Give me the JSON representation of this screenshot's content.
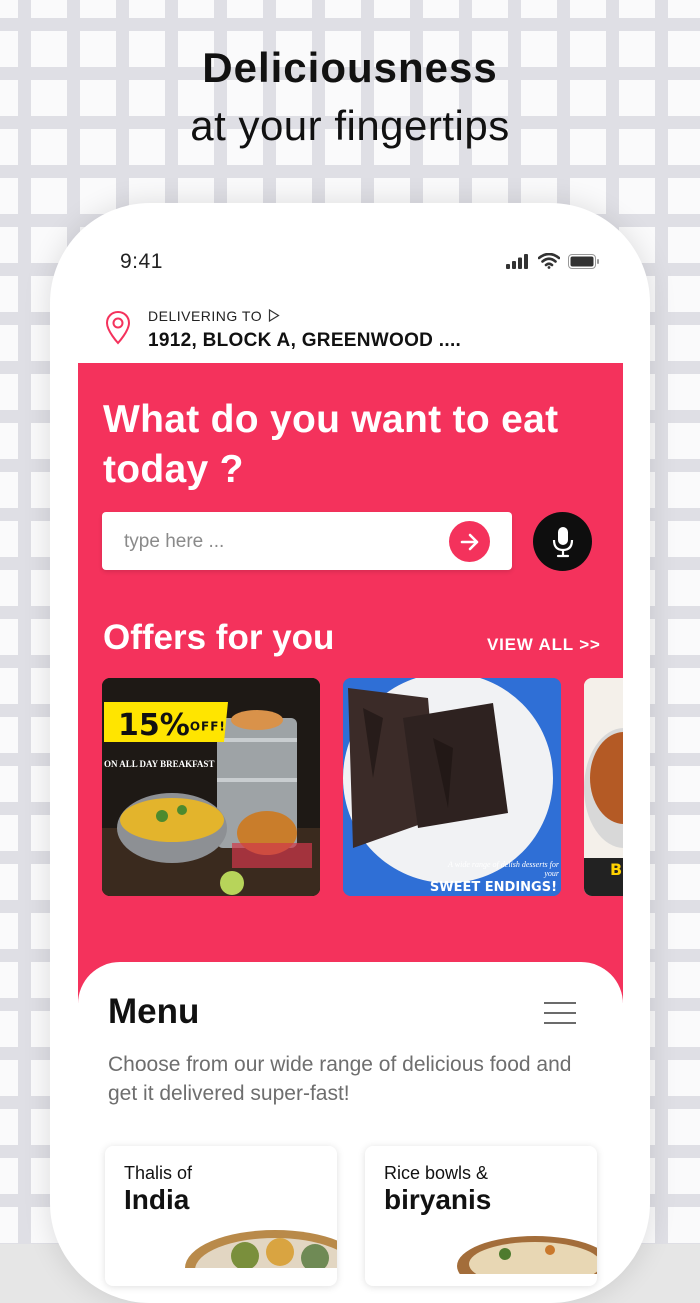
{
  "headline": {
    "line1": "Deliciousness",
    "line2": "at your fingertips"
  },
  "status_bar": {
    "time": "9:41"
  },
  "address": {
    "label": "DELIVERING TO",
    "value": "1912, BLOCK A, GREENWOOD ...."
  },
  "hero": {
    "question": "What do you want to eat today ?",
    "search_placeholder": "type here ...",
    "offers_title": "Offers for you",
    "view_all": "VIEW ALL >>"
  },
  "offers": [
    {
      "badge": "15%",
      "badge_suffix": "OFF!",
      "subtitle": "ON ALL DAY BREAKFAST"
    },
    {
      "caption_small": "A wide range of delish desserts for your",
      "caption_big": "SWEET ENDINGS!"
    },
    {
      "caption_big": "B"
    }
  ],
  "menu": {
    "title": "Menu",
    "description": "Choose from our wide range of delicious food and get it delivered super-fast!",
    "categories": [
      {
        "line1": "Thalis of",
        "line2": "India"
      },
      {
        "line1": "Rice bowls &",
        "line2": "biryanis"
      }
    ]
  },
  "colors": {
    "brand": "#f4325c",
    "mic": "#0e0e0e"
  }
}
